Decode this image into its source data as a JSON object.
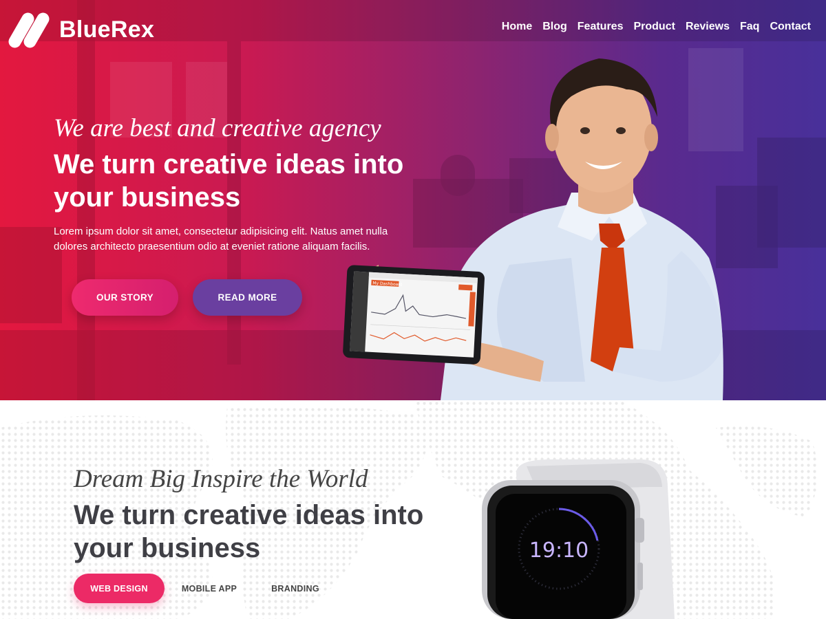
{
  "brand": {
    "name": "BlueRex"
  },
  "nav": {
    "items": [
      "Home",
      "Blog",
      "Features",
      "Product",
      "Reviews",
      "Faq",
      "Contact"
    ]
  },
  "hero": {
    "script": "We are best and creative agency",
    "title": "We turn creative ideas into your business",
    "text": "Lorem ipsum dolor sit amet, consectetur adipisicing elit. Natus amet nulla dolores architecto praesentium odio at eveniet ratione aliquam facilis.",
    "buttons": {
      "story": "OUR STORY",
      "more": "READ MORE"
    },
    "tablet": {
      "title": "My Dashboard"
    }
  },
  "section2": {
    "script": "Dream Big Inspire the World",
    "title": "We turn creative ideas into your business",
    "tabs": [
      "WEB DESIGN",
      "MOBILE APP",
      "BRANDING"
    ],
    "watch_time": "19:10"
  },
  "colors": {
    "primary_pink": "#ec2a66",
    "purple": "#6a3fa0",
    "hero_gradient_start": "#e3183f",
    "hero_gradient_end": "#48309a"
  }
}
